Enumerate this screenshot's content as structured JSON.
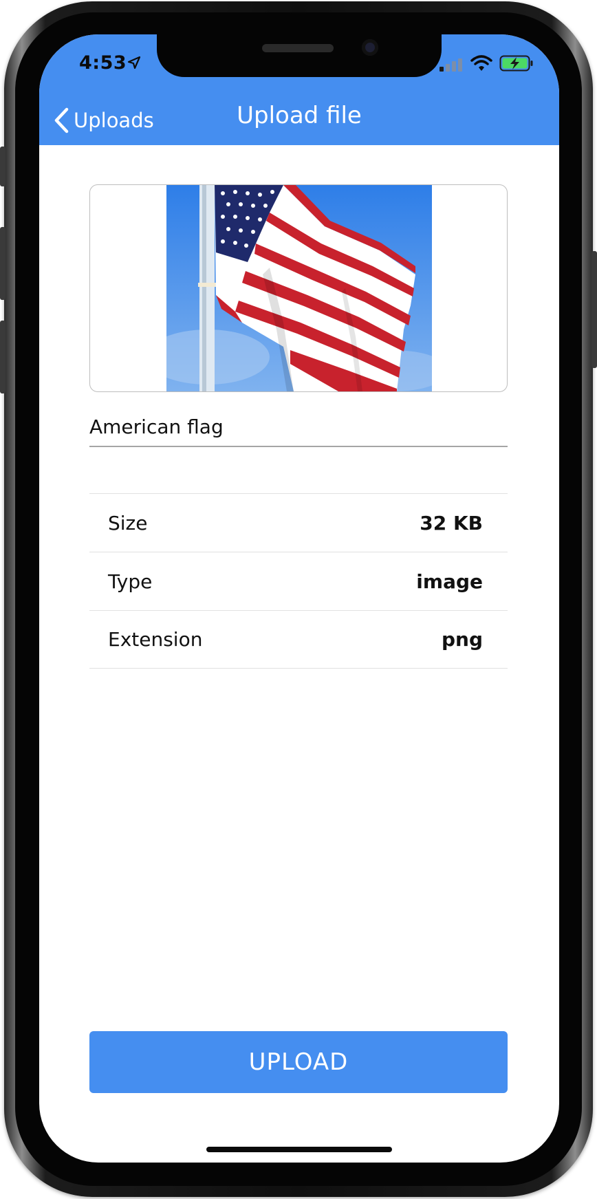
{
  "status_bar": {
    "time": "4:53",
    "icons": [
      "location-arrow-icon",
      "cellular-signal-icon",
      "wifi-icon",
      "battery-charging-icon"
    ]
  },
  "nav": {
    "back_label": "Uploads",
    "back_icon": "chevron-left-icon",
    "title": "Upload file"
  },
  "preview": {
    "image_subject": "american-flag"
  },
  "file": {
    "name_value": "American flag"
  },
  "details": [
    {
      "label": "Size",
      "value": "32 KB"
    },
    {
      "label": "Type",
      "value": "image"
    },
    {
      "label": "Extension",
      "value": "png"
    }
  ],
  "actions": {
    "upload_label": "UPLOAD"
  },
  "colors": {
    "accent": "#458ef0",
    "text": "#111111",
    "divider": "#e1e1e1"
  }
}
